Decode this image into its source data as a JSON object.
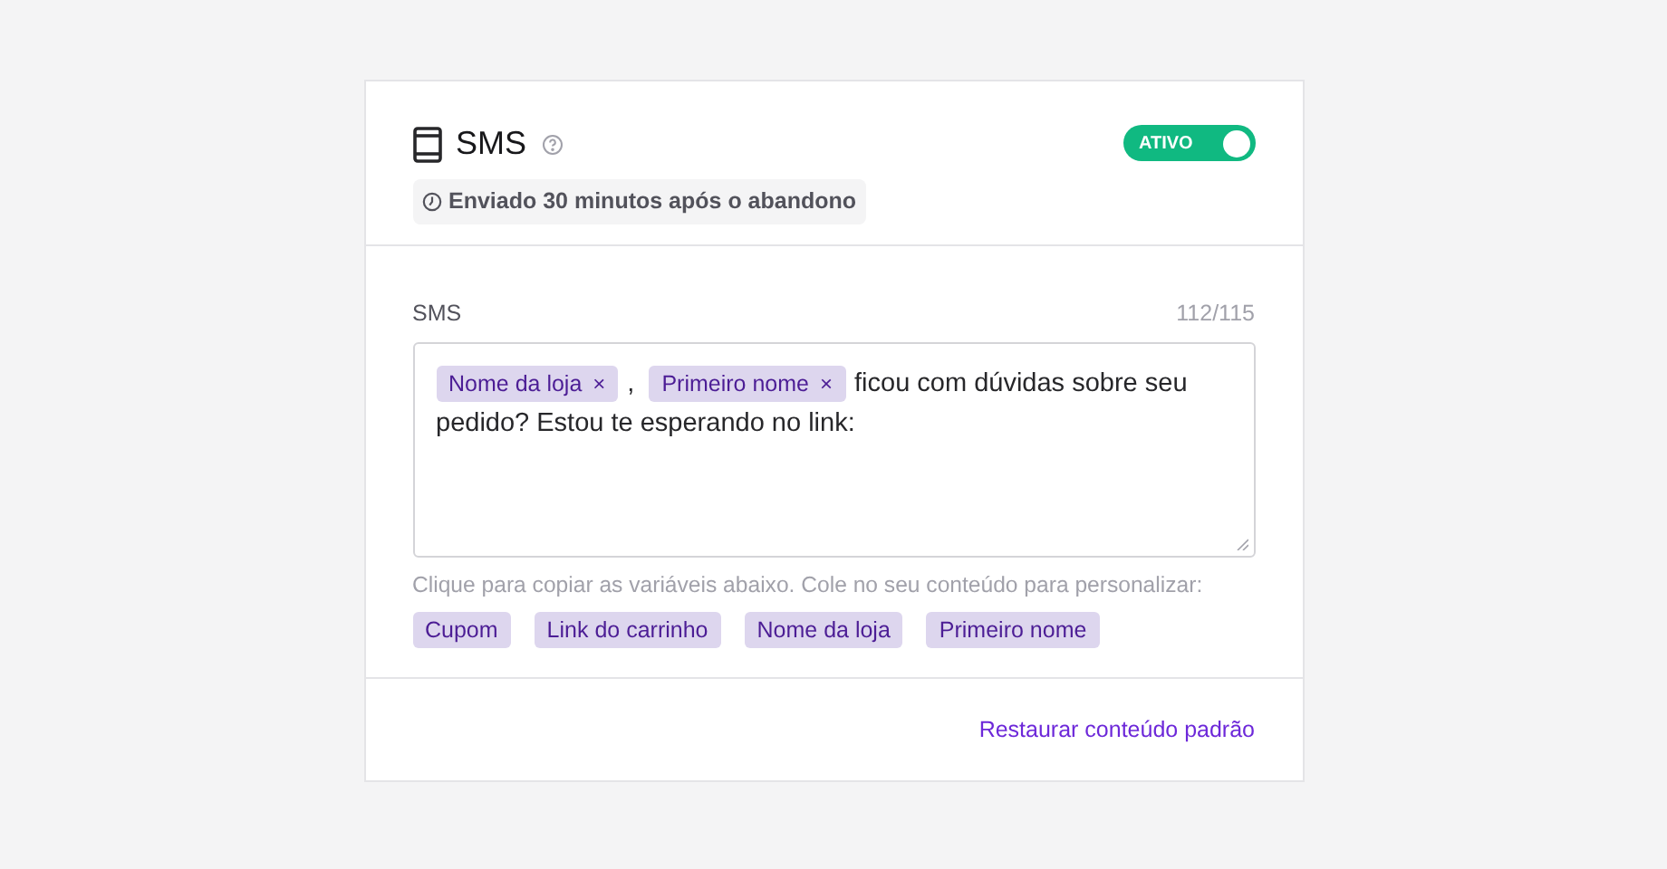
{
  "header": {
    "title": "SMS",
    "subtitle": "Enviado 30 minutos após o abandono",
    "toggle": {
      "label": "ATIVO",
      "on": true
    }
  },
  "editor": {
    "label": "SMS",
    "counter": "112/115",
    "content": [
      {
        "kind": "tag",
        "text": "Nome da loja",
        "remove": "×"
      },
      {
        "kind": "text",
        "text": ","
      },
      {
        "kind": "tag",
        "text": "Primeiro nome",
        "remove": "×"
      },
      {
        "kind": "text",
        "text": "ficou com dúvidas sobre seu"
      },
      {
        "kind": "text",
        "text": "pedido? Estou te esperando no link:"
      }
    ]
  },
  "hint": "Clique para copiar as variáveis abaixo. Cole no seu conteúdo para personalizar:",
  "variables": [
    "Cupom",
    "Link do carrinho",
    "Nome da loja",
    "Primeiro nome"
  ],
  "footer": {
    "link": "Restaurar conteúdo padrão"
  }
}
